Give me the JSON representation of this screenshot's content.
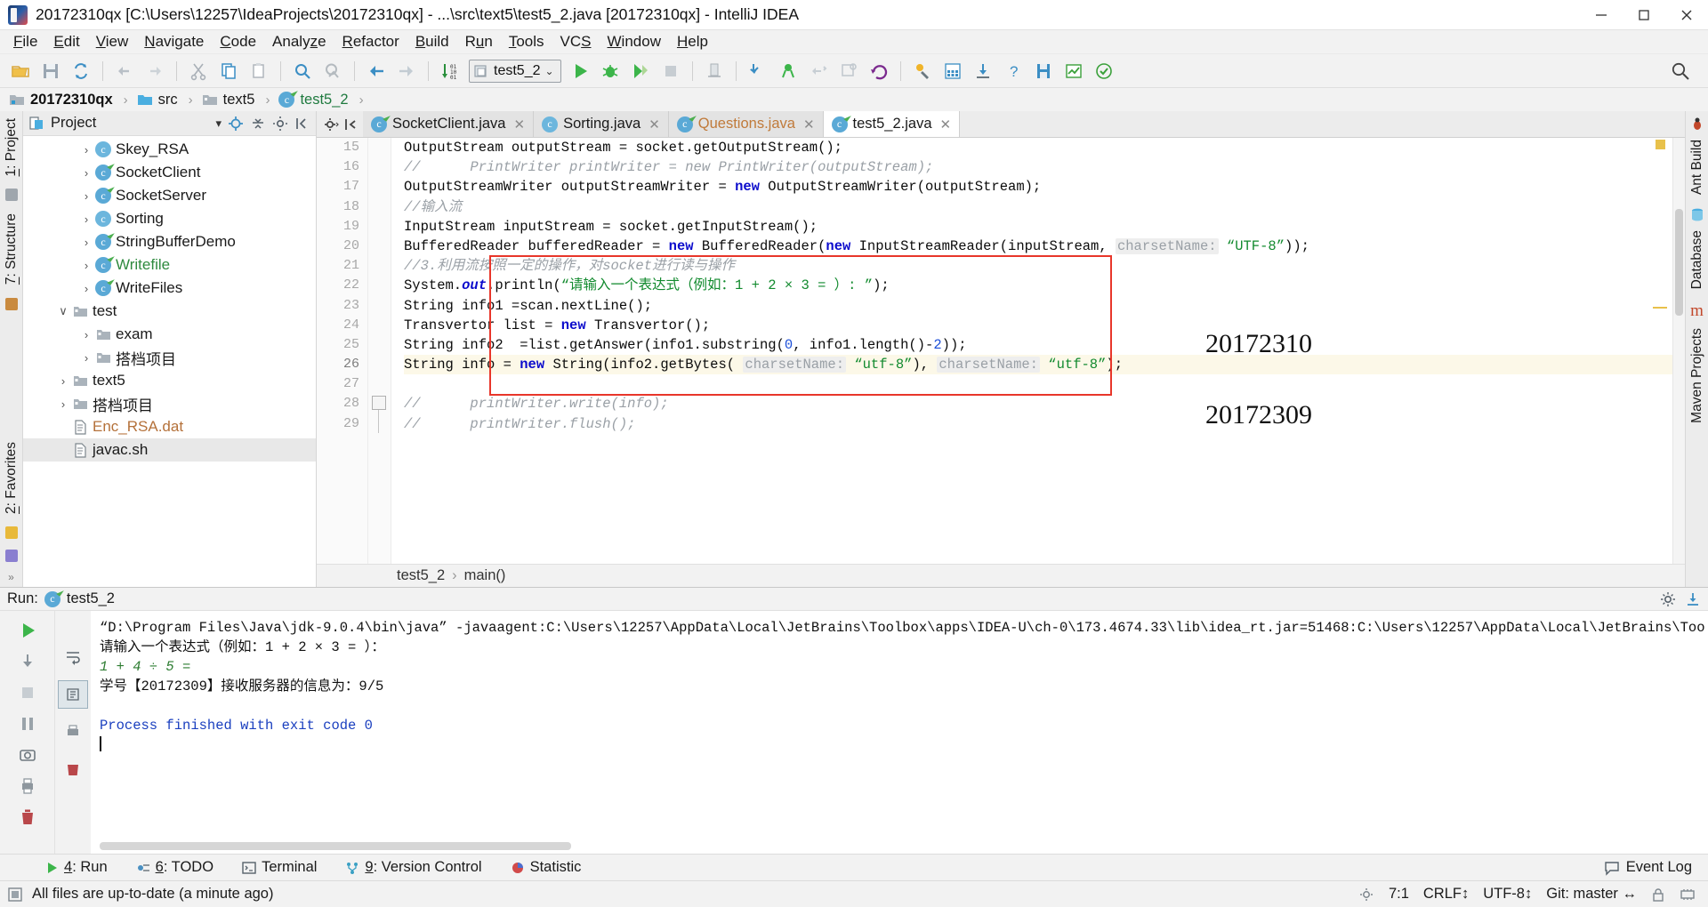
{
  "window": {
    "title": "20172310qx [C:\\Users\\12257\\IdeaProjects\\20172310qx] - ...\\src\\text5\\test5_2.java [20172310qx] - IntelliJ IDEA",
    "minimize": "—",
    "maximize": "❐",
    "close": "✕"
  },
  "menu": {
    "items": [
      "File",
      "Edit",
      "View",
      "Navigate",
      "Code",
      "Analyze",
      "Refactor",
      "Build",
      "Run",
      "Tools",
      "VCS",
      "Window",
      "Help"
    ]
  },
  "toolbar": {
    "run_config": "test5_2",
    "caret": "⌄",
    "icons": [
      "open-folder-icon",
      "save-all-icon",
      "sync-icon",
      "undo-icon",
      "redo-icon",
      "cut-icon",
      "copy-icon",
      "paste-icon",
      "find-icon",
      "find-replace-icon",
      "back-icon",
      "forward-icon",
      "line-numbers-icon"
    ],
    "right_icons": [
      "run-icon",
      "debug-icon",
      "run-coverage-icon",
      "stop-icon",
      "build-icon",
      "update-project-icon",
      "commit-icon",
      "push-icon",
      "compare-icon",
      "revert-icon",
      "settings-icon",
      "project-structure-icon",
      "sdk-icon",
      "help-icon",
      "save-icon",
      "chart-icon",
      "inspect-icon"
    ],
    "search_icon": "search-icon"
  },
  "navbar": {
    "crumbs": [
      {
        "label": "20172310qx",
        "kind": "module",
        "style": "bold"
      },
      {
        "label": "src",
        "kind": "source-folder",
        "style": "normal"
      },
      {
        "label": "text5",
        "kind": "folder",
        "style": "normal"
      },
      {
        "label": "test5_2",
        "kind": "class",
        "style": "green"
      }
    ],
    "separator": "›"
  },
  "left_rail": {
    "project": "1: Project",
    "structure": "7: Structure",
    "favorites": "2: Favorites"
  },
  "right_rail": {
    "ant": "Ant Build",
    "database": "Database",
    "maven": "Maven Projects"
  },
  "project_panel": {
    "title": "Project",
    "collapse_icon": "chevron-down-icon",
    "locate_icon": "locate-target-icon",
    "collapse_all_icon": "collapse-all-icon",
    "settings_icon": "gear-icon",
    "hide_icon": "hide-panel-icon",
    "tree": [
      {
        "label": "Skey_RSA",
        "depth": 2,
        "arrow": "›",
        "icon": "class-icon",
        "color": "normal",
        "selected": false
      },
      {
        "label": "SocketClient",
        "depth": 2,
        "arrow": "›",
        "icon": "class-run-icon",
        "color": "normal",
        "selected": false
      },
      {
        "label": "SocketServer",
        "depth": 2,
        "arrow": "›",
        "icon": "class-run-icon",
        "color": "normal",
        "selected": false
      },
      {
        "label": "Sorting",
        "depth": 2,
        "arrow": "›",
        "icon": "class-icon",
        "color": "normal",
        "selected": false
      },
      {
        "label": "StringBufferDemo",
        "depth": 2,
        "arrow": "›",
        "icon": "class-run-icon",
        "color": "normal",
        "selected": false
      },
      {
        "label": "Writefile",
        "depth": 2,
        "arrow": "›",
        "icon": "class-run-icon",
        "color": "green",
        "selected": false
      },
      {
        "label": "WriteFiles",
        "depth": 2,
        "arrow": "›",
        "icon": "class-run-icon",
        "color": "normal",
        "selected": false
      },
      {
        "label": "test",
        "depth": 1,
        "arrow": "∨",
        "icon": "folder-icon",
        "color": "normal",
        "selected": false
      },
      {
        "label": "exam",
        "depth": 2,
        "arrow": "›",
        "icon": "folder-icon",
        "color": "normal",
        "selected": false
      },
      {
        "label": "搭档项目",
        "depth": 2,
        "arrow": "›",
        "icon": "folder-icon",
        "color": "normal",
        "selected": false
      },
      {
        "label": "text5",
        "depth": 1,
        "arrow": "›",
        "icon": "folder-icon",
        "color": "normal",
        "selected": false
      },
      {
        "label": "搭档项目",
        "depth": 1,
        "arrow": "›",
        "icon": "folder-icon",
        "color": "normal",
        "selected": false
      },
      {
        "label": "Enc_RSA.dat",
        "depth": 1,
        "arrow": "",
        "icon": "file-icon",
        "color": "orange",
        "selected": false
      },
      {
        "label": "javac.sh",
        "depth": 1,
        "arrow": "",
        "icon": "file-icon",
        "color": "normal",
        "selected": true
      }
    ]
  },
  "editor": {
    "gear_icon": "gear-icon",
    "hide_icon": "hide-tabs-icon",
    "tabs": [
      {
        "label": "SocketClient.java",
        "active": false,
        "color": "normal",
        "close": "✕"
      },
      {
        "label": "Sorting.java",
        "active": false,
        "color": "normal",
        "close": "✕"
      },
      {
        "label": "Questions.java",
        "active": false,
        "color": "orange",
        "close": "✕"
      },
      {
        "label": "test5_2.java",
        "active": true,
        "color": "normal",
        "close": "✕"
      }
    ],
    "line_numbers": [
      "15",
      "16",
      "17",
      "18",
      "19",
      "20",
      "21",
      "22",
      "23",
      "24",
      "25",
      "26",
      "27",
      "28",
      "29"
    ],
    "current_line": "26",
    "breadcrumb": [
      "test5_2",
      "main()"
    ],
    "breadcrumb_sep": "›",
    "watermarks": [
      "20172310",
      "20172309"
    ],
    "red_box_color": "#e8362a",
    "lines": [
      {
        "n": "15",
        "segments": [
          {
            "t": "OutputStream outputStream = socket.getOutputStream();",
            "c": "plain"
          }
        ]
      },
      {
        "n": "16",
        "segments": [
          {
            "t": "//      PrintWriter printWriter = new PrintWriter(outputStream);",
            "c": "cm"
          }
        ]
      },
      {
        "n": "17",
        "segments": [
          {
            "t": "OutputStreamWriter outputStreamWriter = ",
            "c": "plain"
          },
          {
            "t": "new",
            "c": "kw"
          },
          {
            "t": " OutputStreamWriter(outputStream);",
            "c": "plain"
          }
        ]
      },
      {
        "n": "18",
        "segments": [
          {
            "t": "//输入流",
            "c": "cm"
          }
        ]
      },
      {
        "n": "19",
        "segments": [
          {
            "t": "InputStream inputStream = socket.getInputStream();",
            "c": "plain"
          }
        ]
      },
      {
        "n": "20",
        "segments": [
          {
            "t": "BufferedReader bufferedReader = ",
            "c": "plain"
          },
          {
            "t": "new",
            "c": "kw"
          },
          {
            "t": " BufferedReader(",
            "c": "plain"
          },
          {
            "t": "new",
            "c": "kw"
          },
          {
            "t": " InputStreamReader(inputStream, ",
            "c": "plain"
          },
          {
            "t": "charsetName:",
            "c": "hint"
          },
          {
            "t": " ",
            "c": "plain"
          },
          {
            "t": "“UTF-8”",
            "c": "strb"
          },
          {
            "t": "));",
            "c": "plain"
          }
        ]
      },
      {
        "n": "21",
        "segments": [
          {
            "t": "//3.利用流按照一定的操作，对socket进行读与操作",
            "c": "cm"
          }
        ]
      },
      {
        "n": "22",
        "segments": [
          {
            "t": "System.",
            "c": "plain"
          },
          {
            "t": "out",
            "c": "kwi"
          },
          {
            "t": ".println(",
            "c": "plain"
          },
          {
            "t": "“请输入一个表达式（例如：1 + 2 × 3 = ）: ”",
            "c": "str"
          },
          {
            "t": ");",
            "c": "plain"
          }
        ]
      },
      {
        "n": "23",
        "segments": [
          {
            "t": "String info1 =scan.nextLine();",
            "c": "plain"
          }
        ]
      },
      {
        "n": "24",
        "segments": [
          {
            "t": "Transvertor list = ",
            "c": "plain"
          },
          {
            "t": "new",
            "c": "kw"
          },
          {
            "t": " Transvertor();",
            "c": "plain"
          }
        ]
      },
      {
        "n": "25",
        "segments": [
          {
            "t": "String info2  =list.getAnswer(info1.substring(",
            "c": "plain"
          },
          {
            "t": "0",
            "c": "num"
          },
          {
            "t": ", info1.length()-",
            "c": "plain"
          },
          {
            "t": "2",
            "c": "num"
          },
          {
            "t": "));",
            "c": "plain"
          }
        ]
      },
      {
        "n": "26",
        "segments": [
          {
            "t": "String info = ",
            "c": "plain"
          },
          {
            "t": "new",
            "c": "kw"
          },
          {
            "t": " String(info2.getBytes( ",
            "c": "plain"
          },
          {
            "t": "charsetName:",
            "c": "hint"
          },
          {
            "t": " ",
            "c": "plain"
          },
          {
            "t": "“utf-8”",
            "c": "strb"
          },
          {
            "t": "), ",
            "c": "plain"
          },
          {
            "t": "charsetName:",
            "c": "hint"
          },
          {
            "t": " ",
            "c": "plain"
          },
          {
            "t": "“utf-8”",
            "c": "strb"
          },
          {
            "t": ");",
            "c": "plain"
          }
        ]
      },
      {
        "n": "27",
        "segments": [
          {
            "t": "",
            "c": "plain"
          }
        ]
      },
      {
        "n": "28",
        "segments": [
          {
            "t": "//      printWriter.write(info);",
            "c": "cm"
          }
        ]
      },
      {
        "n": "29",
        "segments": [
          {
            "t": "//      printWriter.flush();",
            "c": "cm"
          }
        ]
      }
    ]
  },
  "run_panel": {
    "title": "Run:",
    "config": "test5_2",
    "settings_icon": "gear-icon",
    "export_icon": "export-icon",
    "tools": [
      "rerun-icon",
      "rerun-down-icon",
      "stop-icon",
      "pause-icon",
      "camera-icon",
      "print-icon",
      "trash-icon"
    ],
    "tools2": [
      "thread-dump-icon",
      "soft-wrap-icon",
      "scroll-to-end-icon",
      "print-icon-2",
      "clear-all-icon"
    ],
    "console_lines": [
      {
        "text": "“D:\\Program Files\\Java\\jdk-9.0.4\\bin\\java” -javaagent:C:\\Users\\12257\\AppData\\Local\\JetBrains\\Toolbox\\apps\\IDEA-U\\ch-0\\173.4674.33\\lib\\idea_rt.jar=51468:C:\\Users\\12257\\AppData\\Local\\JetBrains\\Too",
        "style": "plain"
      },
      {
        "text": "请输入一个表达式（例如：1 + 2 × 3 = ）：",
        "style": "plain"
      },
      {
        "text": "1 + 4 ÷ 5 =",
        "style": "green"
      },
      {
        "text": "学号【20172309】接收服务器的信息为：9/5",
        "style": "plain"
      },
      {
        "text": "",
        "style": "plain"
      },
      {
        "text": "Process finished with exit code 0",
        "style": "blue"
      }
    ]
  },
  "bottom_tabs": [
    {
      "label": "4: Run",
      "icon": "run-icon",
      "underline_index": 0,
      "active": true
    },
    {
      "label": "6: TODO",
      "icon": "todo-icon",
      "underline_index": 0,
      "active": false
    },
    {
      "label": "Terminal",
      "icon": "terminal-icon",
      "underline_index": -1,
      "active": false
    },
    {
      "label": "9: Version Control",
      "icon": "vcs-icon",
      "underline_index": 0,
      "active": false
    },
    {
      "label": "Statistic",
      "icon": "statistic-icon",
      "underline_index": -1,
      "active": false
    }
  ],
  "event_log": {
    "label": "Event Log",
    "icon": "balloon-icon"
  },
  "statusbar": {
    "message": "All files are up-to-date (a minute ago)",
    "message_icon": "checkbox-icon",
    "caret_position": "7:1",
    "line_separator": "CRLF↕",
    "encoding": "UTF-8↕",
    "branch": "Git: master ↔",
    "right_icons": [
      "gear-icon",
      "lock-icon",
      "memory-icon"
    ]
  }
}
